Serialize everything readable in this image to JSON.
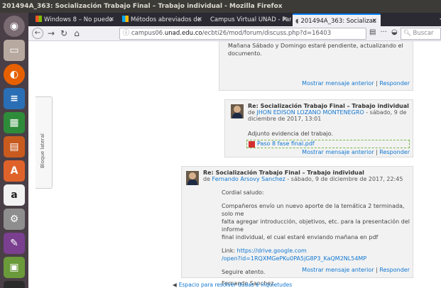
{
  "window": {
    "title": "201494A_363: Socialización Trabajo Final – Trabajo individual - Mozilla Firefox"
  },
  "tabs": [
    {
      "label": "Windows 8 – No puedo"
    },
    {
      "label": "Métodos abreviados de"
    },
    {
      "label": "Campus Virtual UNAD - Par"
    },
    {
      "label": "201494A_363: Socializac"
    }
  ],
  "navbar": {
    "url_prefix": "campus06.",
    "url_host": "unad.edu.co",
    "url_path": "/ecbti26/mod/forum/discuss.php?d=16403",
    "search_placeholder": "Buscar"
  },
  "side_block": {
    "label": "Bloque lateral"
  },
  "post1": {
    "text_line1": "Mañana Sábado y Domingo estaré pendiente, actualizando el",
    "text_line2": "documento.",
    "show_parent": "Mostrar mensaje anterior",
    "separator": "|",
    "reply": "Responder"
  },
  "post2": {
    "subject": "Re: Socialización Trabajo Final – Trabajo individual",
    "byline_prefix": "de",
    "author": "JHON EDISON LOZANO MONTENEGRO",
    "date_line1": " - sábado, 9 de",
    "date_line2": "diciembre de 2017, 13:01",
    "text": "Adjunto evidencia del trabajo.",
    "attachment": "Paso 8 fase final.pdf",
    "show_parent": "Mostrar mensaje anterior",
    "separator": "|",
    "reply": "Responder"
  },
  "post3": {
    "subject": "Re: Socialización Trabajo Final – Trabajo individual",
    "byline_prefix": "de",
    "author": "Fernando Arsovy Sanchez",
    "date": " - sábado, 9 de diciembre de 2017, 22:45",
    "greeting": "Cordial saludo:",
    "body_line1": "Compañeros envío un nuevo aporte de la temática 2 terminada, solo me",
    "body_line2": "falta agregar introducción, objetivos, etc. para la presentación del informe",
    "body_line3": "final individual, el cual estaré enviando mañana en pdf",
    "link_label": "Link:",
    "link_line1": "https://drive.google.com",
    "link_line2": "/open?id=1RQXMGePKu0PA5jG8P3_KaQM2NL54MP",
    "closing": "Seguire atento.",
    "signature": "Fernando Sanchez.",
    "show_parent": "Mostrar mensaje anterior",
    "separator": "|",
    "reply": "Responder"
  },
  "bottom": {
    "link": "Espacio para resolver dudas e inquietudes"
  },
  "colors": {
    "link": "#1177d1",
    "launcher": "#4a3f46",
    "post_bg": "#f2f2f2"
  }
}
